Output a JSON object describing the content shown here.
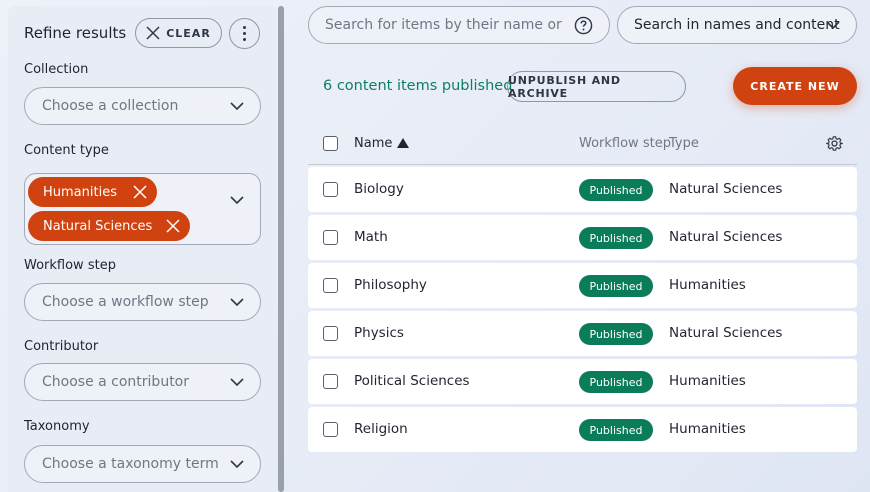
{
  "sidebar": {
    "title": "Refine results",
    "clear_label": "CLEAR",
    "filters": {
      "collection": {
        "label": "Collection",
        "placeholder": "Choose a collection"
      },
      "content_type": {
        "label": "Content type",
        "selected": [
          "Humanities",
          "Natural Sciences"
        ]
      },
      "workflow_step": {
        "label": "Workflow step",
        "placeholder": "Choose a workflow step"
      },
      "contributor": {
        "label": "Contributor",
        "placeholder": "Choose a contributor"
      },
      "taxonomy": {
        "label": "Taxonomy",
        "placeholder": "Choose a taxonomy term"
      }
    }
  },
  "search": {
    "placeholder": "Search for items by their name or content",
    "scope": "Search in names and content"
  },
  "toolbar": {
    "count_text": "6 content items published",
    "unpublish_label": "UNPUBLISH AND ARCHIVE",
    "create_label": "CREATE NEW"
  },
  "table": {
    "columns": {
      "name": "Name",
      "workflow": "Workflow step",
      "type": "Type"
    },
    "rows": [
      {
        "name": "Biology",
        "status": "Published",
        "type": "Natural Sciences"
      },
      {
        "name": "Math",
        "status": "Published",
        "type": "Natural Sciences"
      },
      {
        "name": "Philosophy",
        "status": "Published",
        "type": "Humanities"
      },
      {
        "name": "Physics",
        "status": "Published",
        "type": "Natural Sciences"
      },
      {
        "name": "Political Sciences",
        "status": "Published",
        "type": "Humanities"
      },
      {
        "name": "Religion",
        "status": "Published",
        "type": "Humanities"
      }
    ]
  },
  "colors": {
    "accent": "#d0420f",
    "published_badge": "#0b7c5a",
    "count_text": "#0d7f61"
  },
  "icons": [
    "close-icon",
    "kebab-menu-icon",
    "chevron-down-icon",
    "help-icon",
    "sort-ascending-icon",
    "gear-icon"
  ]
}
